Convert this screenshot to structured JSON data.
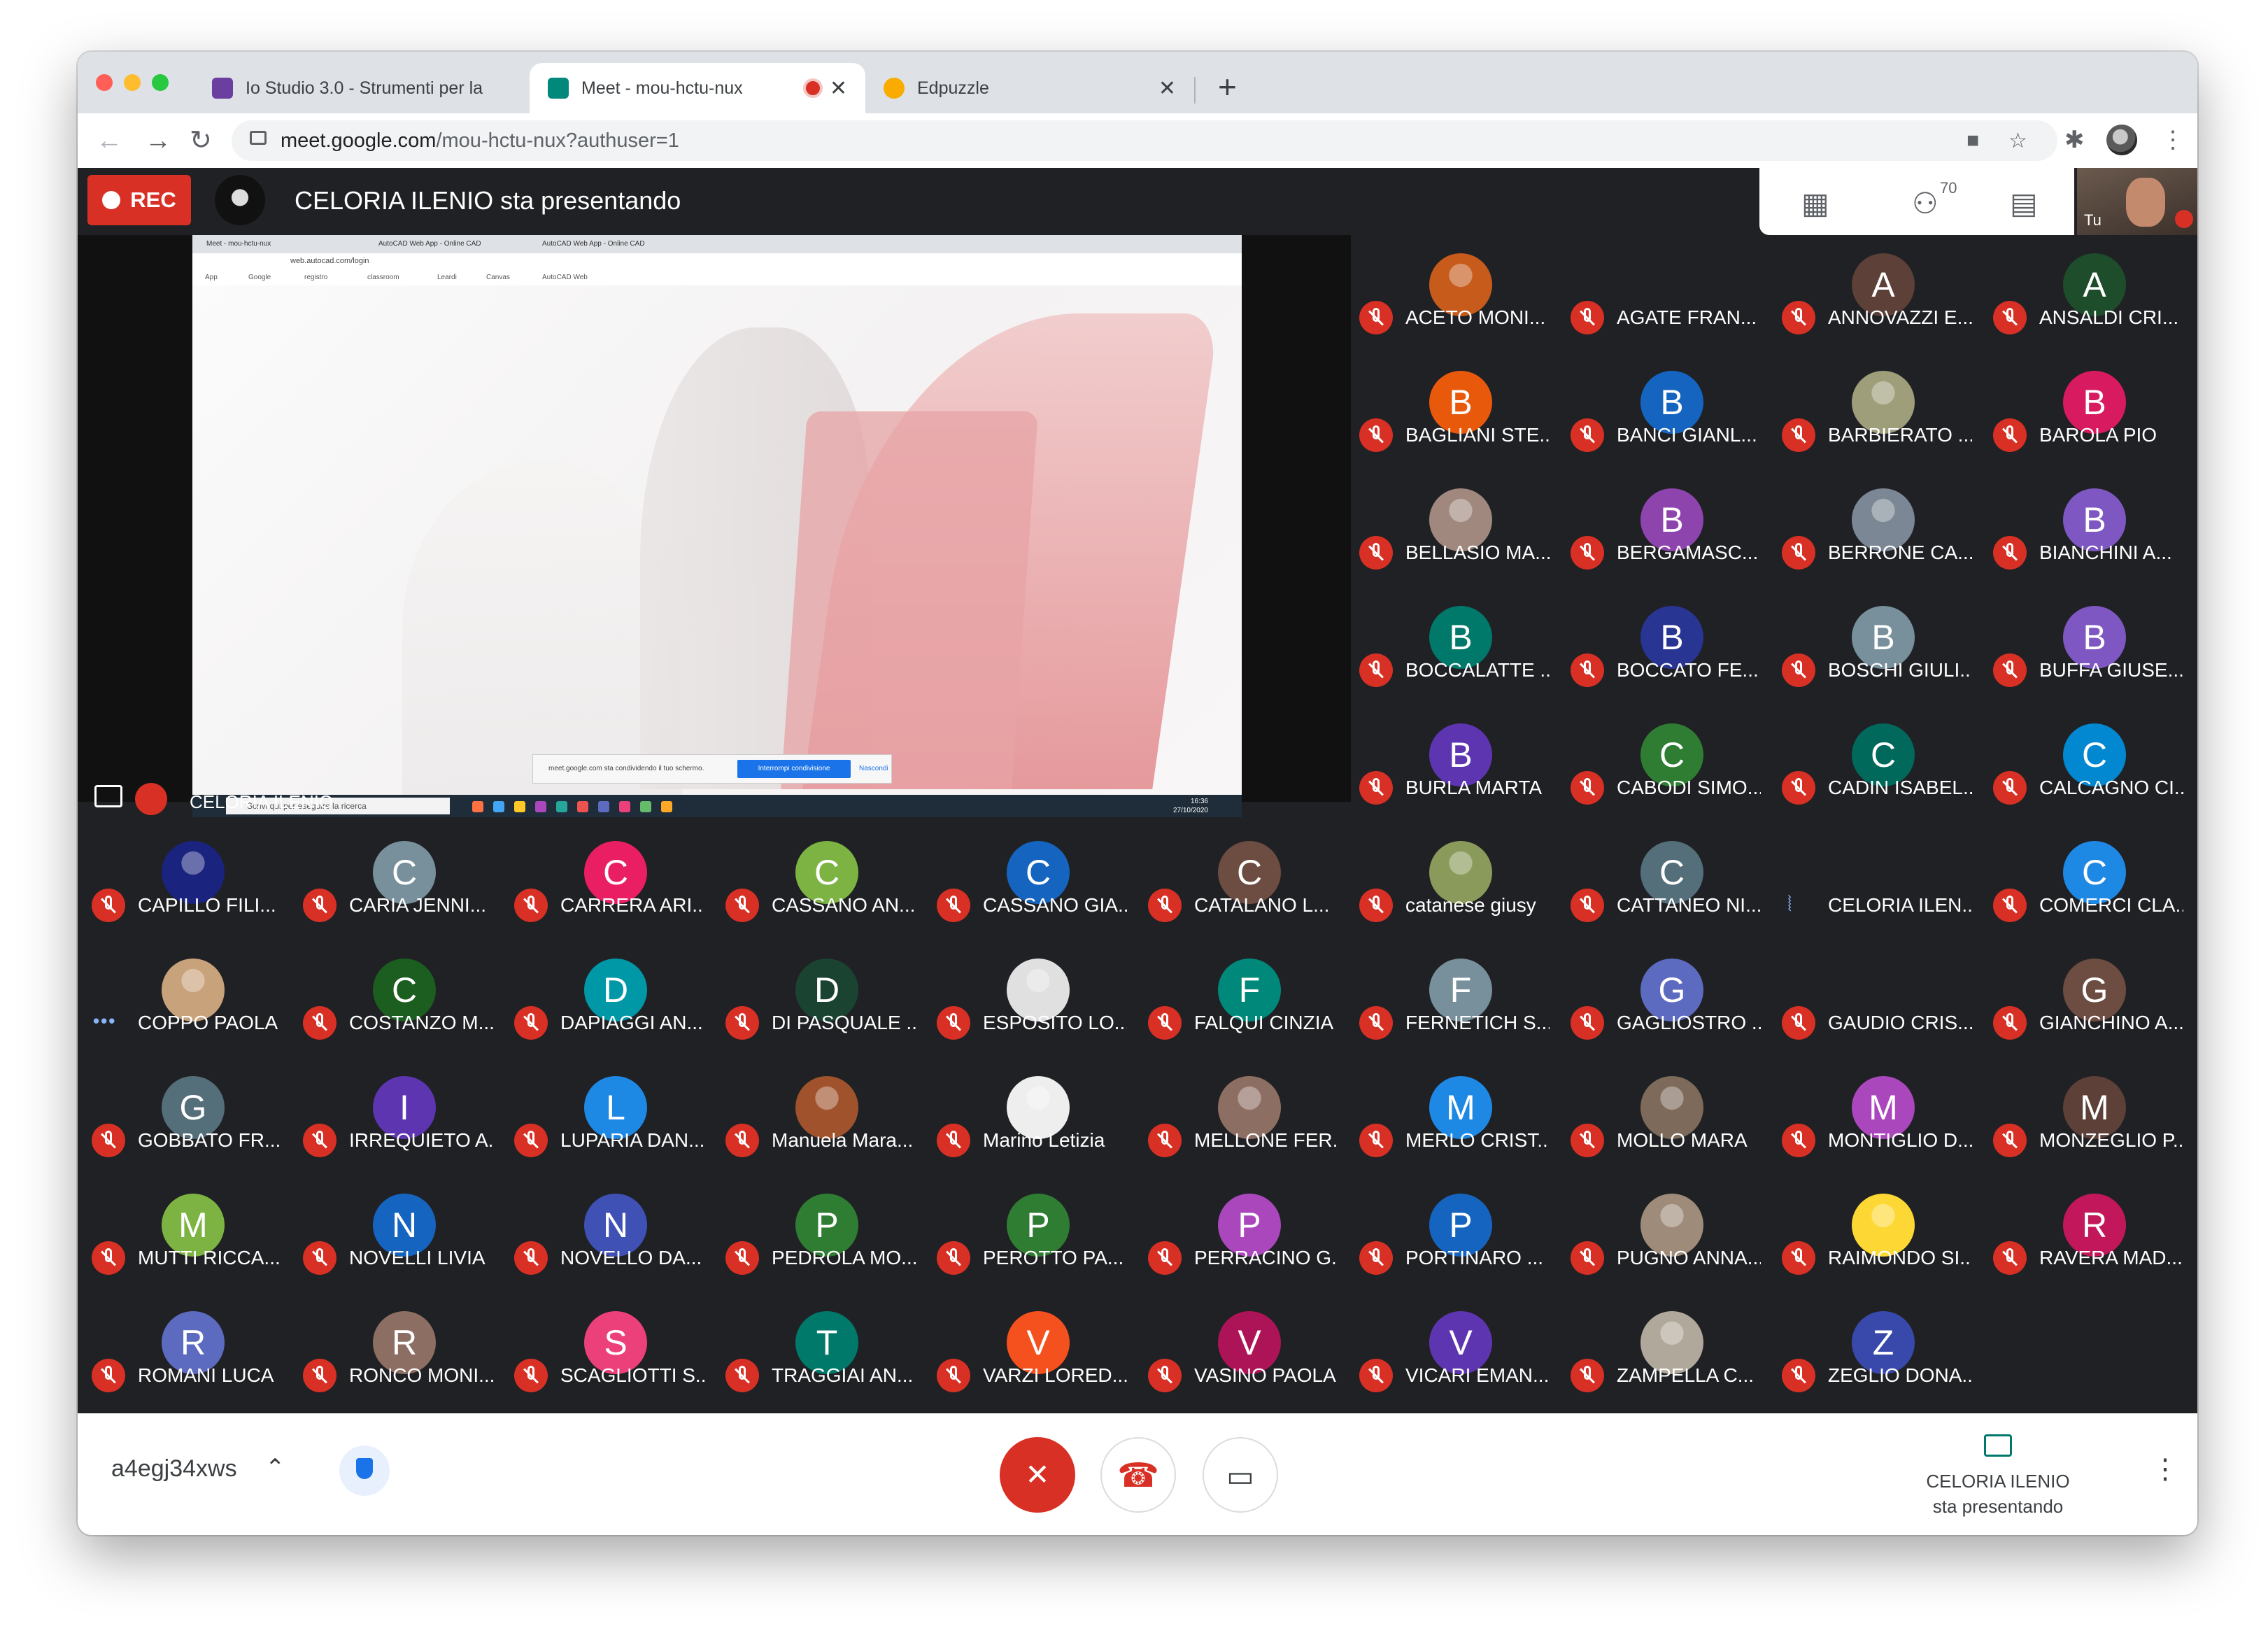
{
  "browser": {
    "tabs": [
      {
        "label": "Io Studio 3.0 - Strumenti per la",
        "favicon_color": "#6b3fa0"
      },
      {
        "label": "Meet - mou-hctu-nux",
        "favicon_color": "#00897b",
        "recording": true
      },
      {
        "label": "Edpuzzle",
        "favicon_color": "#f9ab00"
      }
    ],
    "close_glyph": "✕",
    "new_tab_glyph": "+",
    "url_host": "meet.google.com",
    "url_path": "/mou-hctu-nux?authuser=1"
  },
  "meet": {
    "rec_label": "REC",
    "presenting_text": "CELORIA ILENIO sta presentando",
    "participant_count": "70",
    "self_label": "Tu",
    "share": {
      "presenter_label": "CELORIA ILENIO",
      "inner_tabs": [
        "Meet - mou-hctu-nux",
        "AutoCAD Web App - Online CAD",
        "AutoCAD Web App - Online CAD"
      ],
      "inner_url": "web.autocad.com/login",
      "bookmarks": [
        "App",
        "Google",
        "registro",
        "classroom",
        "Leardi",
        "Canvas",
        "AutoCAD Web"
      ],
      "share_notice": "meet.google.com sta condividendo il tuo schermo.",
      "stop_sharing": "Interrompi condivisione",
      "hide": "Nascondi",
      "taskbar_search": "Scrivi qui per eseguire la ricerca",
      "clock_time": "16:36",
      "clock_date": "27/10/2020"
    },
    "tiles": [
      {
        "name": "ACETO MONI...",
        "initial": "",
        "color": "#c75b1c",
        "status": "muted",
        "photo": true
      },
      {
        "name": "AGATE FRAN...",
        "initial": "",
        "color": "#8d6e63",
        "status": "muted",
        "video": true
      },
      {
        "name": "ANNOVAZZI E...",
        "initial": "A",
        "color": "#5d4037",
        "status": "muted"
      },
      {
        "name": "ANSALDI CRI...",
        "initial": "A",
        "color": "#1e4d2b",
        "status": "muted"
      },
      {
        "name": "BAGLIANI STE...",
        "initial": "B",
        "color": "#e8590c",
        "status": "muted"
      },
      {
        "name": "BANCI GIANL...",
        "initial": "B",
        "color": "#1565c0",
        "status": "muted"
      },
      {
        "name": "BARBIERATO ...",
        "initial": "",
        "color": "#9e9e7a",
        "status": "muted",
        "photo": true
      },
      {
        "name": "BAROLA PIO",
        "initial": "B",
        "color": "#d81b60",
        "status": "muted"
      },
      {
        "name": "BELLASIO MA...",
        "initial": "",
        "color": "#a1887f",
        "status": "muted",
        "photo": true
      },
      {
        "name": "BERGAMASC...",
        "initial": "B",
        "color": "#8e44ad",
        "status": "muted"
      },
      {
        "name": "BERRONE CA...",
        "initial": "",
        "color": "#7b8794",
        "status": "muted",
        "photo": true
      },
      {
        "name": "BIANCHINI A...",
        "initial": "B",
        "color": "#7e57c2",
        "status": "muted"
      },
      {
        "name": "BOCCALATTE ...",
        "initial": "B",
        "color": "#00796b",
        "status": "muted"
      },
      {
        "name": "BOCCATO FE...",
        "initial": "B",
        "color": "#283593",
        "status": "muted"
      },
      {
        "name": "BOSCHI GIULI...",
        "initial": "B",
        "color": "#78909c",
        "status": "muted"
      },
      {
        "name": "BUFFA GIUSE...",
        "initial": "B",
        "color": "#7e57c2",
        "status": "muted"
      },
      {
        "name": "BURLA MARTA",
        "initial": "B",
        "color": "#5e35b1",
        "status": "muted"
      },
      {
        "name": "CABODI SIMO...",
        "initial": "C",
        "color": "#2e7d32",
        "status": "muted"
      },
      {
        "name": "CADIN ISABEL...",
        "initial": "C",
        "color": "#00695c",
        "status": "muted"
      },
      {
        "name": "CALCAGNO CI...",
        "initial": "C",
        "color": "#0288d1",
        "status": "muted"
      },
      {
        "name": "CAPILLO FILI...",
        "initial": "",
        "color": "#1a237e",
        "status": "muted",
        "photo": true
      },
      {
        "name": "CARIA JENNI...",
        "initial": "C",
        "color": "#78909c",
        "status": "muted"
      },
      {
        "name": "CARRERA ARI...",
        "initial": "C",
        "color": "#e91e63",
        "status": "muted"
      },
      {
        "name": "CASSANO AN...",
        "initial": "C",
        "color": "#7cb342",
        "status": "muted"
      },
      {
        "name": "CASSANO GIA...",
        "initial": "C",
        "color": "#1565c0",
        "status": "muted"
      },
      {
        "name": "CATALANO L...",
        "initial": "C",
        "color": "#6d4c41",
        "status": "muted"
      },
      {
        "name": "catanese giusy",
        "initial": "",
        "color": "#8a9a5b",
        "status": "muted",
        "photo": true
      },
      {
        "name": "CATTANEO NI...",
        "initial": "C",
        "color": "#546e7a",
        "status": "muted"
      },
      {
        "name": "CELORIA ILEN...",
        "initial": "",
        "color": "#b9b4aa",
        "status": "speaking",
        "video": true
      },
      {
        "name": "COMERCI CLA...",
        "initial": "C",
        "color": "#1e88e5",
        "status": "muted"
      },
      {
        "name": "COPPO PAOLA",
        "initial": "",
        "color": "#c8a27a",
        "status": "connecting",
        "photo": true
      },
      {
        "name": "COSTANZO M...",
        "initial": "C",
        "color": "#1b5e20",
        "status": "muted"
      },
      {
        "name": "DAPIAGGI AN...",
        "initial": "D",
        "color": "#0097a7",
        "status": "muted"
      },
      {
        "name": "DI PASQUALE ...",
        "initial": "D",
        "color": "#1b4332",
        "status": "muted"
      },
      {
        "name": "ESPOSITO LO...",
        "initial": "",
        "color": "#e0e0e0",
        "status": "muted",
        "photo": true
      },
      {
        "name": "FALQUI CINZIA",
        "initial": "F",
        "color": "#00897b",
        "status": "muted"
      },
      {
        "name": "FERNETICH S...",
        "initial": "F",
        "color": "#78909c",
        "status": "muted"
      },
      {
        "name": "GAGLIOSTRO ...",
        "initial": "G",
        "color": "#5c6bc0",
        "status": "muted"
      },
      {
        "name": "GAUDIO CRIS...",
        "initial": "",
        "color": "#4a6b8a",
        "status": "muted",
        "video": true
      },
      {
        "name": "GIANCHINO A...",
        "initial": "G",
        "color": "#6d4c41",
        "status": "muted"
      },
      {
        "name": "GOBBATO FR...",
        "initial": "G",
        "color": "#546e7a",
        "status": "muted"
      },
      {
        "name": "IRREQUIETO A...",
        "initial": "I",
        "color": "#5e35b1",
        "status": "muted"
      },
      {
        "name": "LUPARIA DAN...",
        "initial": "L",
        "color": "#1e88e5",
        "status": "muted"
      },
      {
        "name": "Manuela Mara...",
        "initial": "",
        "color": "#a0522d",
        "status": "muted",
        "photo": true
      },
      {
        "name": "Marino Letizia",
        "initial": "",
        "color": "#eeeeee",
        "status": "muted",
        "photo": true
      },
      {
        "name": "MELLONE FER...",
        "initial": "",
        "color": "#8d6e63",
        "status": "muted",
        "photo": true
      },
      {
        "name": "MERLO CRIST...",
        "initial": "M",
        "color": "#1e88e5",
        "status": "muted"
      },
      {
        "name": "MOLLO MARA",
        "initial": "",
        "color": "#7d6a5a",
        "status": "muted",
        "photo": true
      },
      {
        "name": "MONTIGLIO D...",
        "initial": "M",
        "color": "#ab47bc",
        "status": "muted"
      },
      {
        "name": "MONZEGLIO P...",
        "initial": "M",
        "color": "#5d4037",
        "status": "muted"
      },
      {
        "name": "MUTTI RICCA...",
        "initial": "M",
        "color": "#7cb342",
        "status": "muted"
      },
      {
        "name": "NOVELLI LIVIA",
        "initial": "N",
        "color": "#1565c0",
        "status": "muted"
      },
      {
        "name": "NOVELLO DA...",
        "initial": "N",
        "color": "#3f51b5",
        "status": "muted"
      },
      {
        "name": "PEDROLA MO...",
        "initial": "P",
        "color": "#2e7d32",
        "status": "muted"
      },
      {
        "name": "PEROTTO PA...",
        "initial": "P",
        "color": "#2e7d32",
        "status": "muted"
      },
      {
        "name": "PERRACINO G...",
        "initial": "P",
        "color": "#ab47bc",
        "status": "muted"
      },
      {
        "name": "PORTINARO ...",
        "initial": "P",
        "color": "#1565c0",
        "status": "muted"
      },
      {
        "name": "PUGNO ANNA...",
        "initial": "",
        "color": "#9e8b7a",
        "status": "muted",
        "photo": true
      },
      {
        "name": "RAIMONDO SI...",
        "initial": "",
        "color": "#fdd835",
        "status": "muted",
        "photo": true
      },
      {
        "name": "RAVERA MAD...",
        "initial": "R",
        "color": "#c2185b",
        "status": "muted"
      },
      {
        "name": "ROMANI LUCA",
        "initial": "R",
        "color": "#5c6bc0",
        "status": "muted"
      },
      {
        "name": "RONCO MONI...",
        "initial": "R",
        "color": "#8d6e63",
        "status": "muted"
      },
      {
        "name": "SCAGLIOTTI S...",
        "initial": "S",
        "color": "#ec407a",
        "status": "muted"
      },
      {
        "name": "TRAGGIAI AN...",
        "initial": "T",
        "color": "#00796b",
        "status": "muted"
      },
      {
        "name": "VARZI LORED...",
        "initial": "V",
        "color": "#f4511e",
        "status": "muted"
      },
      {
        "name": "VASINO PAOLA",
        "initial": "V",
        "color": "#ad1457",
        "status": "muted"
      },
      {
        "name": "VICARI EMAN...",
        "initial": "V",
        "color": "#5e35b1",
        "status": "muted"
      },
      {
        "name": "ZAMPELLA C...",
        "initial": "",
        "color": "#b0a89a",
        "status": "muted",
        "photo": true
      },
      {
        "name": "ZEGLIO DONA...",
        "initial": "Z",
        "color": "#3949ab",
        "status": "muted"
      }
    ]
  },
  "bottom": {
    "meeting_code": "a4egj34xws",
    "presenter_name": "CELORIA ILENIO",
    "presenter_status": "sta presentando"
  },
  "colors": {
    "mute_red": "#d93025",
    "meet_bg": "#202124",
    "accent_blue": "#1a73e8"
  },
  "icons": [
    "grid-icon",
    "people-icon",
    "chat-icon",
    "mic-off-icon",
    "hangup-icon",
    "camera-icon",
    "shield-icon",
    "present-icon"
  ]
}
